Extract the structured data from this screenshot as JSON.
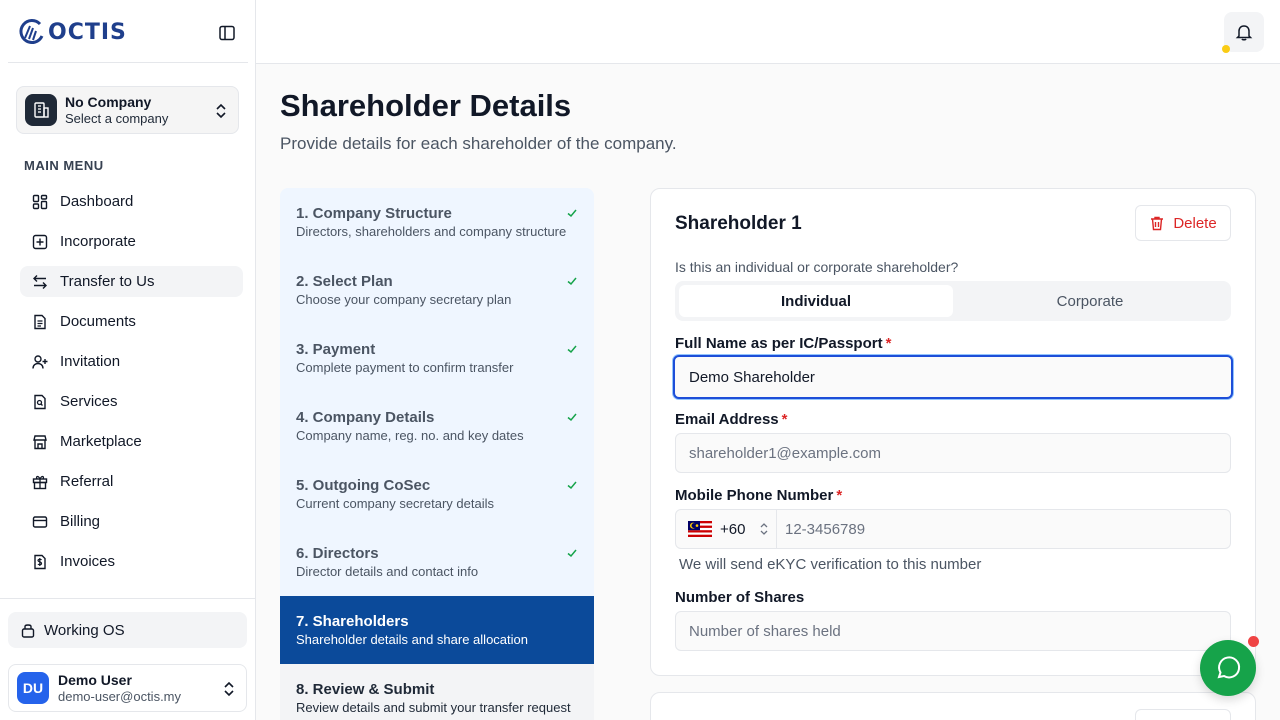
{
  "brand": {
    "name": "OCTIS",
    "color": "#1f3f8c"
  },
  "company_switcher": {
    "name": "No Company",
    "subtitle": "Select a company"
  },
  "sidebar": {
    "heading": "MAIN MENU",
    "items": [
      {
        "label": "Dashboard",
        "icon": "dashboard-icon"
      },
      {
        "label": "Incorporate",
        "icon": "plus-square-icon"
      },
      {
        "label": "Transfer to Us",
        "icon": "transfer-arrows-icon",
        "active": true
      },
      {
        "label": "Documents",
        "icon": "document-icon"
      },
      {
        "label": "Invitation",
        "icon": "user-plus-icon"
      },
      {
        "label": "Services",
        "icon": "file-search-icon"
      },
      {
        "label": "Marketplace",
        "icon": "store-icon"
      },
      {
        "label": "Referral",
        "icon": "gift-icon"
      },
      {
        "label": "Billing",
        "icon": "credit-card-icon"
      },
      {
        "label": "Invoices",
        "icon": "dollar-doc-icon"
      }
    ],
    "working_os": "Working OS"
  },
  "user": {
    "initials": "DU",
    "name": "Demo User",
    "email": "demo-user@octis.my"
  },
  "page": {
    "title": "Shareholder Details",
    "subtitle": "Provide details for each shareholder of the company."
  },
  "steps": [
    {
      "title": "1. Company Structure",
      "desc": "Directors, shareholders and company structure",
      "status": "done"
    },
    {
      "title": "2. Select Plan",
      "desc": "Choose your company secretary plan",
      "status": "done"
    },
    {
      "title": "3. Payment",
      "desc": "Complete payment to confirm transfer",
      "status": "done"
    },
    {
      "title": "4. Company Details",
      "desc": "Company name, reg. no. and key dates",
      "status": "done"
    },
    {
      "title": "5. Outgoing CoSec",
      "desc": "Current company secretary details",
      "status": "done"
    },
    {
      "title": "6. Directors",
      "desc": "Director details and contact info",
      "status": "done"
    },
    {
      "title": "7. Shareholders",
      "desc": "Shareholder details and share allocation",
      "status": "current"
    },
    {
      "title": "8. Review & Submit",
      "desc": "Review details and submit your transfer request",
      "status": "upcoming"
    }
  ],
  "form": {
    "title": "Shareholder 1",
    "delete_label": "Delete",
    "type_question": "Is this an individual or corporate shareholder?",
    "type_options": [
      "Individual",
      "Corporate"
    ],
    "type_selected": "Individual",
    "full_name_label": "Full Name as per IC/Passport",
    "full_name_value": "Demo Shareholder",
    "email_label": "Email Address",
    "email_placeholder": "shareholder1@example.com",
    "phone_label": "Mobile Phone Number",
    "phone_country_code": "+60",
    "phone_placeholder": "12-3456789",
    "phone_hint": "We will send eKYC verification to this number",
    "shares_label": "Number of Shares",
    "shares_placeholder": "Number of shares held",
    "required_mark": "*"
  },
  "colors": {
    "accent": "#0b4a9a",
    "danger": "#dc2626",
    "chat": "#16a34a"
  }
}
